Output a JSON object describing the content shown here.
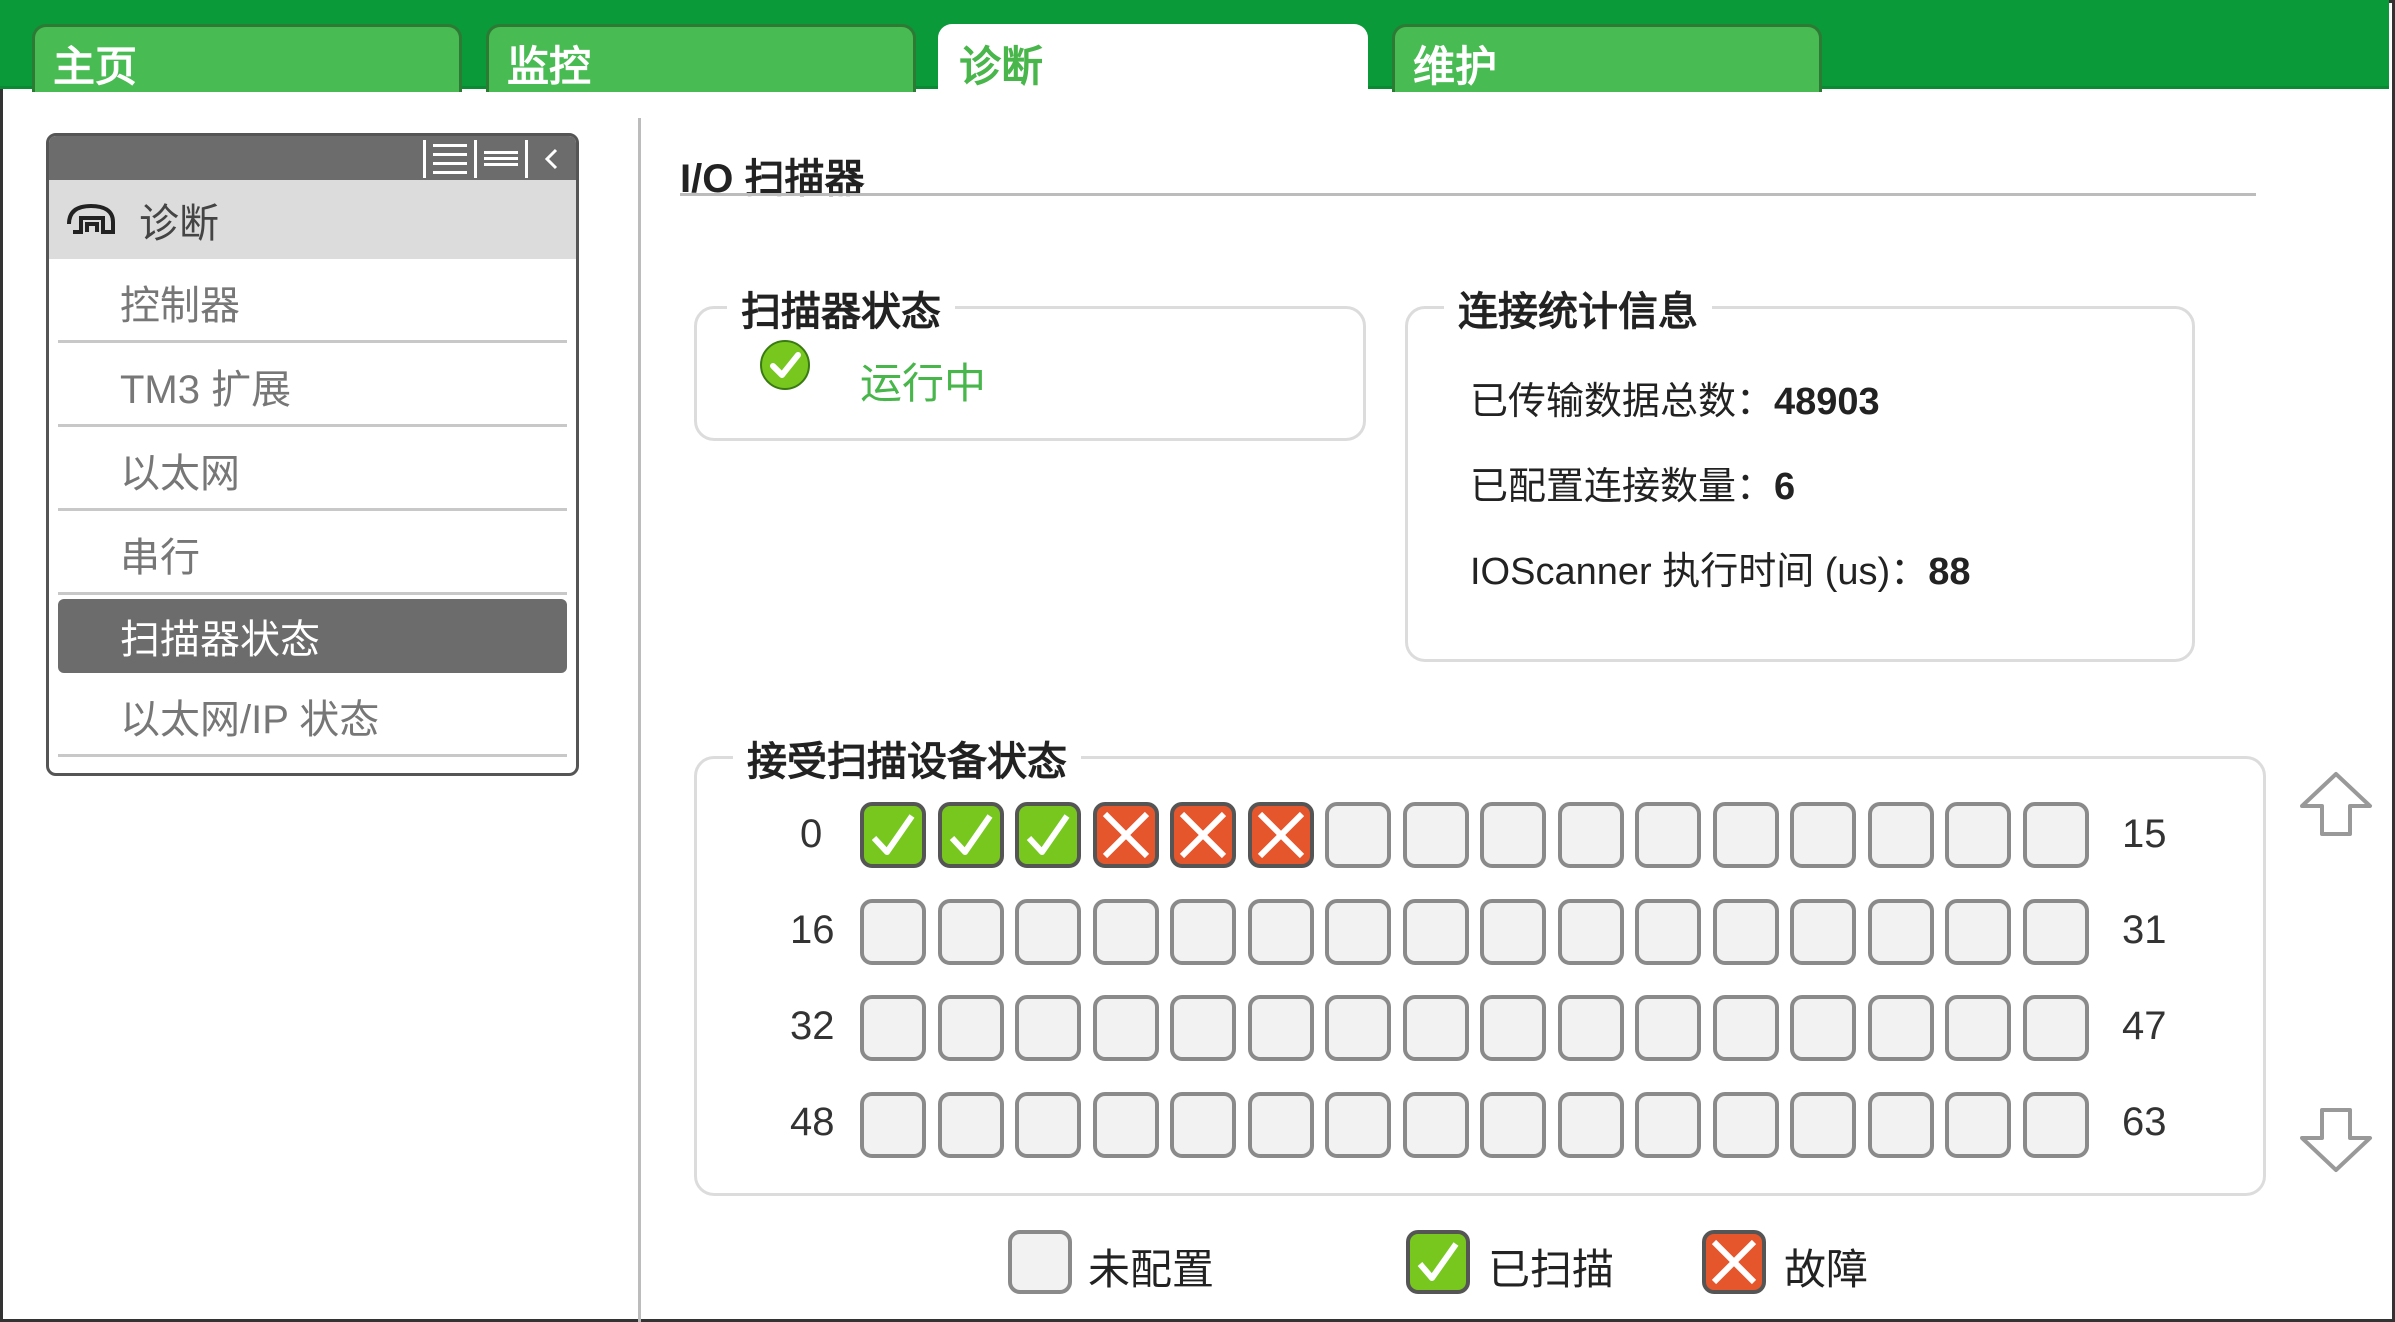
{
  "tabs": [
    {
      "label": "主页"
    },
    {
      "label": "监控"
    },
    {
      "label": "诊断"
    },
    {
      "label": "维护"
    }
  ],
  "active_tab": 2,
  "menu": {
    "header": "诊断",
    "items": [
      {
        "label": "控制器"
      },
      {
        "label": "TM3 扩展"
      },
      {
        "label": "以太网"
      },
      {
        "label": "串行"
      },
      {
        "label": "扫描器状态"
      },
      {
        "label": "以太网/IP 状态"
      }
    ],
    "selected_index": 4
  },
  "page": {
    "title": "I/O 扫描器"
  },
  "scanner_status": {
    "label": "扫描器状态",
    "status": "运行中"
  },
  "connection_stats": {
    "label": "连接统计信息",
    "total_data_label": "已传输数据总数：",
    "total_data_value": "48903",
    "configured_label": "已配置连接数量：",
    "configured_value": "6",
    "exec_time_label": "IOScanner 执行时间 (us)：",
    "exec_time_value": "88"
  },
  "device_status": {
    "label": "接受扫描设备状态",
    "rows": [
      {
        "start": "0",
        "end": "15"
      },
      {
        "start": "16",
        "end": "31"
      },
      {
        "start": "32",
        "end": "47"
      },
      {
        "start": "48",
        "end": "63"
      }
    ],
    "cells_per_row": 16,
    "scanned_devices": [
      0,
      1,
      2
    ],
    "fault_devices": [
      3,
      4,
      5
    ]
  },
  "legend": {
    "not_configured": "未配置",
    "scanned": "已扫描",
    "fault": "故障"
  },
  "colors": {
    "brand_green": "#0a9a3a",
    "tab_green": "#48bb52",
    "scanned_green": "#78c71f",
    "fault_orange": "#e5562d",
    "status_green": "#48b64a"
  }
}
